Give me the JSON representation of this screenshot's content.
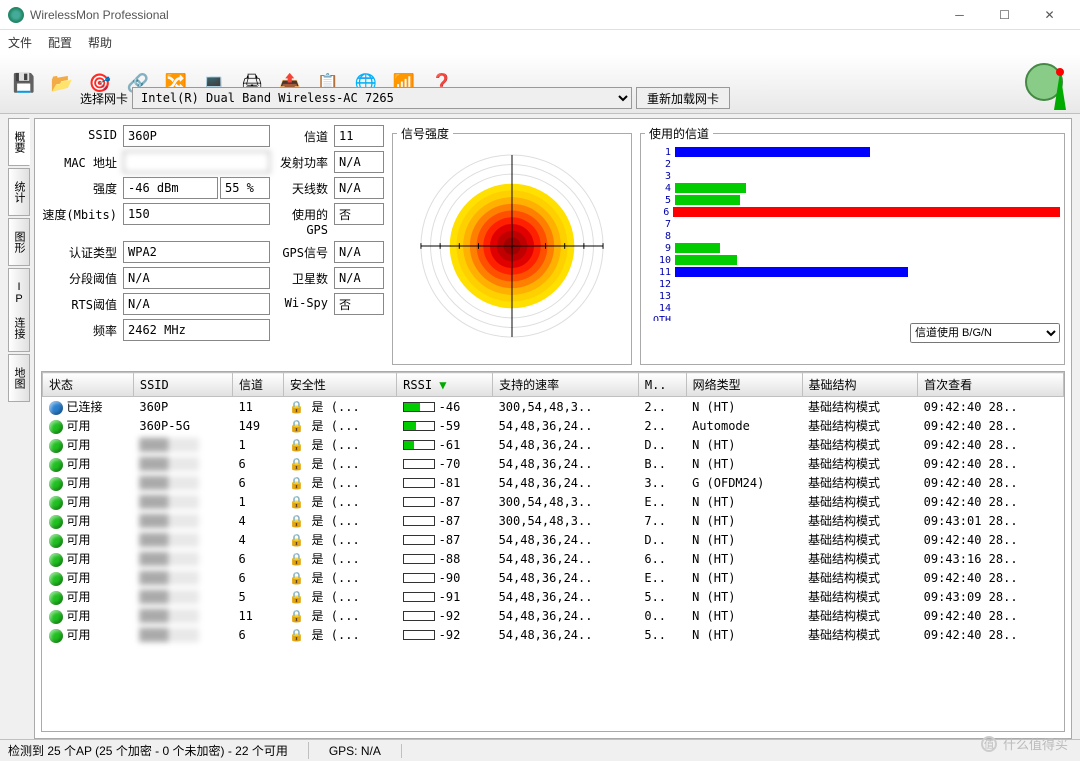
{
  "window": {
    "title": "WirelessMon Professional"
  },
  "menu": {
    "file": "文件",
    "config": "配置",
    "help": "帮助"
  },
  "toolbar": {
    "save": "💾",
    "open": "📂",
    "target": "🎯",
    "net1": "🔗",
    "net2": "🔀",
    "net3": "💻",
    "scan": "🖨",
    "export": "📤",
    "report": "📋",
    "globe": "🌐",
    "wifi": "📶",
    "help": "❓"
  },
  "adapter": {
    "label": "选择网卡",
    "selected": "Intel(R) Dual Band Wireless-AC 7265",
    "reload": "重新加载网卡"
  },
  "tabs": [
    "概要",
    "统计",
    "图形",
    "IP 连接",
    "地图"
  ],
  "fields": {
    "ssid_label": "SSID",
    "ssid": "360P",
    "channel_label": "信道",
    "channel": "11",
    "mac_label": "MAC 地址",
    "mac": "",
    "txpower_label": "发射功率",
    "txpower": "N/A",
    "strength_label": "强度",
    "strength_dbm": "-46 dBm",
    "strength_pct": "55 %",
    "antennas_label": "天线数",
    "antennas": "N/A",
    "speed_label": "速度(Mbits)",
    "speed": "150",
    "gps_used_label": "使用的GPS",
    "gps_used": "否",
    "auth_label": "认证类型",
    "auth": "WPA2",
    "gps_signal_label": "GPS信号",
    "gps_signal": "N/A",
    "frag_label": "分段阈值",
    "frag": "N/A",
    "sats_label": "卫星数",
    "sats": "N/A",
    "rts_label": "RTS阈值",
    "rts": "N/A",
    "wispy_label": "Wi-Spy",
    "wispy": "否",
    "freq_label": "频率",
    "freq": "2462 MHz"
  },
  "signal_title": "信号强度",
  "channels_title": "使用的信道",
  "channel_select": "信道使用 B/G/N",
  "chart_data": {
    "type": "bar",
    "title": "使用的信道",
    "xlabel": "",
    "ylabel": "",
    "categories": [
      "1",
      "2",
      "3",
      "4",
      "5",
      "6",
      "7",
      "8",
      "9",
      "10",
      "11",
      "12",
      "13",
      "14",
      "OTH"
    ],
    "series": [
      {
        "name": "usage",
        "values": [
          150,
          0,
          0,
          55,
          50,
          320,
          0,
          0,
          35,
          48,
          180,
          0,
          0,
          0,
          0
        ],
        "colors": [
          "#00f",
          "#00f",
          "#00f",
          "#0c0",
          "#0c0",
          "#f00",
          "#00f",
          "#00f",
          "#0c0",
          "#0c0",
          "#00f",
          "#00f",
          "#00f",
          "#00f",
          "#00f"
        ]
      }
    ],
    "xlim": [
      0,
      320
    ]
  },
  "grid": {
    "headers": [
      "状态",
      "SSID",
      "信道",
      "安全性",
      "RSSI",
      "支持的速率",
      "M..",
      "网络类型",
      "基础结构",
      "首次查看"
    ],
    "rows": [
      {
        "status": "已连接",
        "dot": "#2a80d0",
        "ssid": "360P",
        "ssid_blur": false,
        "ch": "11",
        "sec": "是 (...",
        "rssi": -46,
        "bar": 55,
        "barcolor": "#0c0",
        "rates": "300,54,48,3..",
        "m": "2..",
        "net": "N (HT)",
        "infra": "基础结构模式",
        "first": "09:42:40 28.."
      },
      {
        "status": "可用",
        "dot": "#20c020",
        "ssid": "360P-5G",
        "ssid_blur": false,
        "ch": "149",
        "sec": "是 (...",
        "rssi": -59,
        "bar": 40,
        "barcolor": "#0c0",
        "rates": "54,48,36,24..",
        "m": "2..",
        "net": "Automode",
        "infra": "基础结构模式",
        "first": "09:42:40 28.."
      },
      {
        "status": "可用",
        "dot": "#20c020",
        "ssid": "████",
        "ssid_blur": true,
        "ch": "1",
        "sec": "是 (...",
        "rssi": -61,
        "bar": 35,
        "barcolor": "#0c0",
        "rates": "54,48,36,24..",
        "m": "D..",
        "net": "N (HT)",
        "infra": "基础结构模式",
        "first": "09:42:40 28.."
      },
      {
        "status": "可用",
        "dot": "#20c020",
        "ssid": "████",
        "ssid_blur": true,
        "ch": "6",
        "sec": "是 (...",
        "rssi": -70,
        "bar": 20,
        "barcolor": "#fff",
        "rates": "54,48,36,24..",
        "m": "B..",
        "net": "N (HT)",
        "infra": "基础结构模式",
        "first": "09:42:40 28.."
      },
      {
        "status": "可用",
        "dot": "#20c020",
        "ssid": "████",
        "ssid_blur": true,
        "ch": "6",
        "sec": "是 (...",
        "rssi": -81,
        "bar": 12,
        "barcolor": "#fff",
        "rates": "54,48,36,24..",
        "m": "3..",
        "net": "G (OFDM24)",
        "infra": "基础结构模式",
        "first": "09:42:40 28.."
      },
      {
        "status": "可用",
        "dot": "#20c020",
        "ssid": "████",
        "ssid_blur": true,
        "ch": "1",
        "sec": "是 (...",
        "rssi": -87,
        "bar": 8,
        "barcolor": "#fff",
        "rates": "300,54,48,3..",
        "m": "E..",
        "net": "N (HT)",
        "infra": "基础结构模式",
        "first": "09:42:40 28.."
      },
      {
        "status": "可用",
        "dot": "#20c020",
        "ssid": "████",
        "ssid_blur": true,
        "ch": "4",
        "sec": "是 (...",
        "rssi": -87,
        "bar": 8,
        "barcolor": "#fff",
        "rates": "300,54,48,3..",
        "m": "7..",
        "net": "N (HT)",
        "infra": "基础结构模式",
        "first": "09:43:01 28.."
      },
      {
        "status": "可用",
        "dot": "#20c020",
        "ssid": "████",
        "ssid_blur": true,
        "ch": "4",
        "sec": "是 (...",
        "rssi": -87,
        "bar": 8,
        "barcolor": "#fff",
        "rates": "54,48,36,24..",
        "m": "D..",
        "net": "N (HT)",
        "infra": "基础结构模式",
        "first": "09:42:40 28.."
      },
      {
        "status": "可用",
        "dot": "#20c020",
        "ssid": "████",
        "ssid_blur": true,
        "ch": "6",
        "sec": "是 (...",
        "rssi": -88,
        "bar": 7,
        "barcolor": "#fff",
        "rates": "54,48,36,24..",
        "m": "6..",
        "net": "N (HT)",
        "infra": "基础结构模式",
        "first": "09:43:16 28.."
      },
      {
        "status": "可用",
        "dot": "#20c020",
        "ssid": "████",
        "ssid_blur": true,
        "ch": "6",
        "sec": "是 (...",
        "rssi": -90,
        "bar": 6,
        "barcolor": "#fff",
        "rates": "54,48,36,24..",
        "m": "E..",
        "net": "N (HT)",
        "infra": "基础结构模式",
        "first": "09:42:40 28.."
      },
      {
        "status": "可用",
        "dot": "#20c020",
        "ssid": "████",
        "ssid_blur": true,
        "ch": "5",
        "sec": "是 (...",
        "rssi": -91,
        "bar": 5,
        "barcolor": "#fff",
        "rates": "54,48,36,24..",
        "m": "5..",
        "net": "N (HT)",
        "infra": "基础结构模式",
        "first": "09:43:09 28.."
      },
      {
        "status": "可用",
        "dot": "#20c020",
        "ssid": "████",
        "ssid_blur": true,
        "ch": "11",
        "sec": "是 (...",
        "rssi": -92,
        "bar": 4,
        "barcolor": "#fff",
        "rates": "54,48,36,24..",
        "m": "0..",
        "net": "N (HT)",
        "infra": "基础结构模式",
        "first": "09:42:40 28.."
      },
      {
        "status": "可用",
        "dot": "#20c020",
        "ssid": "████",
        "ssid_blur": true,
        "ch": "6",
        "sec": "是 (...",
        "rssi": -92,
        "bar": 4,
        "barcolor": "#fff",
        "rates": "54,48,36,24..",
        "m": "5..",
        "net": "N (HT)",
        "infra": "基础结构模式",
        "first": "09:42:40 28.."
      }
    ]
  },
  "statusbar": {
    "ap": "检测到 25 个AP (25 个加密 - 0 个未加密) - 22 个可用",
    "gps": "GPS: N/A"
  },
  "watermark": "什么值得买"
}
